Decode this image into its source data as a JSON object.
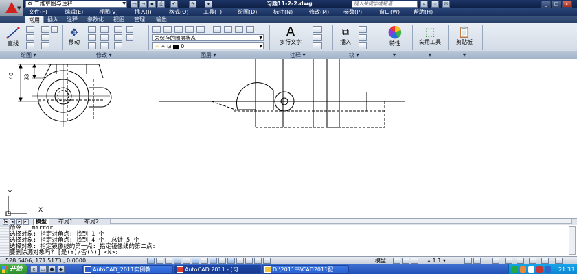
{
  "titlebar": {
    "workspace": "二维草图与注释",
    "doc_title": "习题11-2-2.dwg",
    "search_placeholder": "键入关键字或短语",
    "window_min": "_",
    "window_max": "□",
    "window_close": "×"
  },
  "menubar": {
    "items": [
      "文件(F)",
      "编辑(E)",
      "视图(V)",
      "插入(I)",
      "格式(O)",
      "工具(T)",
      "绘图(D)",
      "标注(N)",
      "修改(M)",
      "参数(P)",
      "窗口(W)",
      "帮助(H)"
    ]
  },
  "ribbon_tabs": [
    "常用",
    "插入",
    "注释",
    "参数化",
    "视图",
    "管理",
    "输出"
  ],
  "ribbon": {
    "draw": {
      "line_label": "直线",
      "panel_label": "绘图"
    },
    "modify": {
      "move_label": "移动",
      "panel_label": "修改"
    },
    "layers": {
      "state_combo": "未保存的图层状态",
      "layer_combo": "0",
      "panel_label": "图层"
    },
    "annotation": {
      "mtext_label": "多行文字",
      "panel_label": "注释"
    },
    "block": {
      "insert_label": "插入",
      "panel_label": "块"
    },
    "properties_label": "特性",
    "utilities_label": "实用工具",
    "clipboard_label": "剪贴板"
  },
  "drawing": {
    "dim_40": "40",
    "dim_33": "33",
    "ucs_y": "Y",
    "ucs_x": "X"
  },
  "layout_tabs": [
    "模型",
    "布局1",
    "布局2"
  ],
  "command_lines": [
    "命令: _mirror",
    "选择对象: 指定对角点: 找到 1 个",
    "选择对象: 指定对角点: 找到 4 个, 总计 5 个",
    "选择对象:  指定镜像线的第一点: 指定镜像线的第二点:",
    "要删除源对象吗? [是(Y)/否(N)] <N>:"
  ],
  "statusbar": {
    "coords": "528.5406, 171.5173 , 0.0000",
    "model_label": "模型",
    "scale": "1:1",
    "time": "21:33"
  },
  "taskbar": {
    "start": "开始",
    "tasks": [
      "AutoCAD_2011实例教...",
      "AutoCAD 2011 - [习...",
      "D:\\2011书\\CAD2011配..."
    ]
  },
  "colors": {
    "title_bg": "#1d3566",
    "taskbar_bg": "#2150b6",
    "start_green": "#3c9e3a",
    "autocad_red": "#d0221b"
  }
}
